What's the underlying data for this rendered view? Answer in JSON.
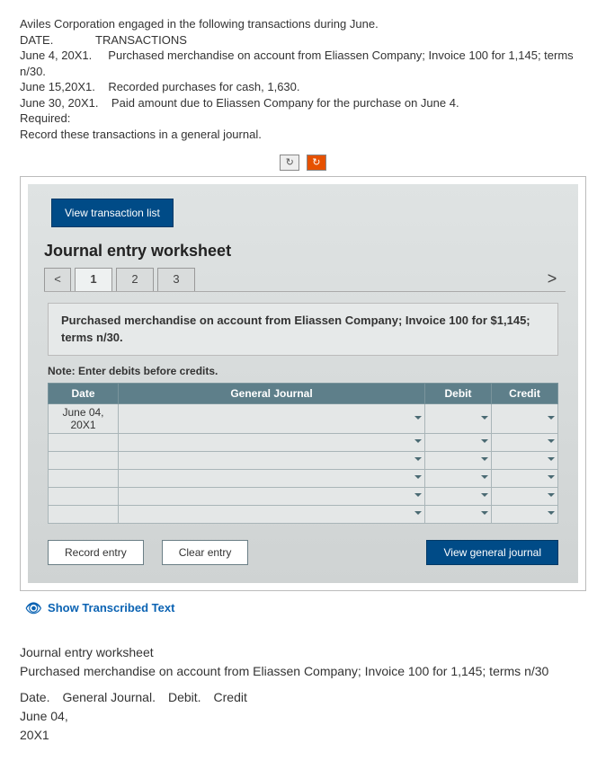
{
  "problem": {
    "line1": "Aviles Corporation engaged in the following transactions during June.",
    "date_hdr": "DATE.",
    "trans_hdr": "TRANSACTIONS",
    "t1a": "June 4, 20X1.",
    "t1b": "Purchased merchandise on account from Eliassen Company; Invoice 100 for 1,145; terms",
    "t1c": "n/30.",
    "t2a": "June 15,20X1.",
    "t2b": "Recorded purchases for cash, 1,630.",
    "t3a": "June 30, 20X1.",
    "t3b": "Paid amount due to Eliassen Company for the purchase on June 4.",
    "req": "Required:",
    "req2": "Record these transactions in a general journal."
  },
  "tools": {
    "refresh": "↻",
    "refresh2": "↻"
  },
  "worksheet": {
    "view_list": "View transaction list",
    "title": "Journal entry worksheet",
    "nav_prev": "<",
    "nav_next": ">",
    "tabs": [
      "1",
      "2",
      "3"
    ],
    "active_tab": 0,
    "description": "Purchased merchandise on account from Eliassen Company; Invoice 100 for $1,145; terms n/30.",
    "note": "Note: Enter debits before credits.",
    "headers": {
      "date": "Date",
      "gj": "General Journal",
      "debit": "Debit",
      "credit": "Credit"
    },
    "first_date_a": "June 04,",
    "first_date_b": "20X1",
    "buttons": {
      "record": "Record entry",
      "clear": "Clear entry",
      "view": "View general journal"
    }
  },
  "show_transcribed": "Show Transcribed Text",
  "transcribed": {
    "l1": "Journal entry worksheet",
    "l2": "Purchased merchandise on account from Eliassen Company; Invoice 100 for 1,145; terms n/30",
    "hdr": "Date. General Journal. Debit. Credit",
    "d1": "June 04,",
    "d2": "20X1"
  }
}
